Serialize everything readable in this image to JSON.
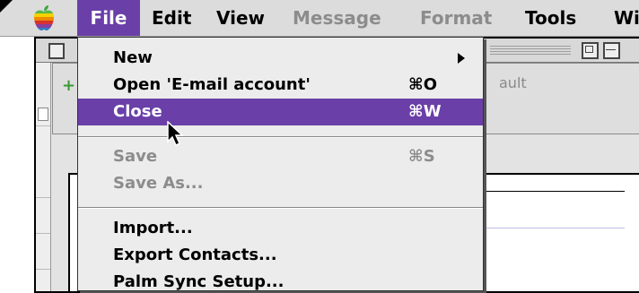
{
  "menubar": {
    "items": [
      {
        "label": "File",
        "state": "active"
      },
      {
        "label": "Edit",
        "state": "enabled"
      },
      {
        "label": "View",
        "state": "enabled"
      },
      {
        "label": "Message",
        "state": "disabled"
      },
      {
        "label": "Format",
        "state": "disabled"
      },
      {
        "label": "Tools",
        "state": "enabled"
      },
      {
        "label": "Wi",
        "state": "enabled"
      }
    ],
    "apple_icon": "apple-menu-icon"
  },
  "file_menu": {
    "items": [
      {
        "label": "New",
        "shortcut": "",
        "submenu": true,
        "state": "enabled"
      },
      {
        "label": "Open 'E-mail account'",
        "shortcut": "⌘O",
        "state": "enabled"
      },
      {
        "label": "Close",
        "shortcut": "⌘W",
        "state": "highlighted"
      },
      {
        "label": "Save",
        "shortcut": "⌘S",
        "state": "disabled"
      },
      {
        "label": "Save As...",
        "shortcut": "",
        "state": "disabled"
      },
      {
        "label": "Import...",
        "shortcut": "",
        "state": "enabled"
      },
      {
        "label": "Export Contacts...",
        "shortcut": "",
        "state": "enabled"
      },
      {
        "label": "Palm Sync Setup...",
        "shortcut": "",
        "state": "enabled"
      }
    ]
  },
  "window": {
    "toolbar_text": "ault"
  },
  "colors": {
    "highlight": "#6a3fa8",
    "menubar_bg": "#dcdcdc",
    "disabled_text": "#8c8c8c"
  }
}
